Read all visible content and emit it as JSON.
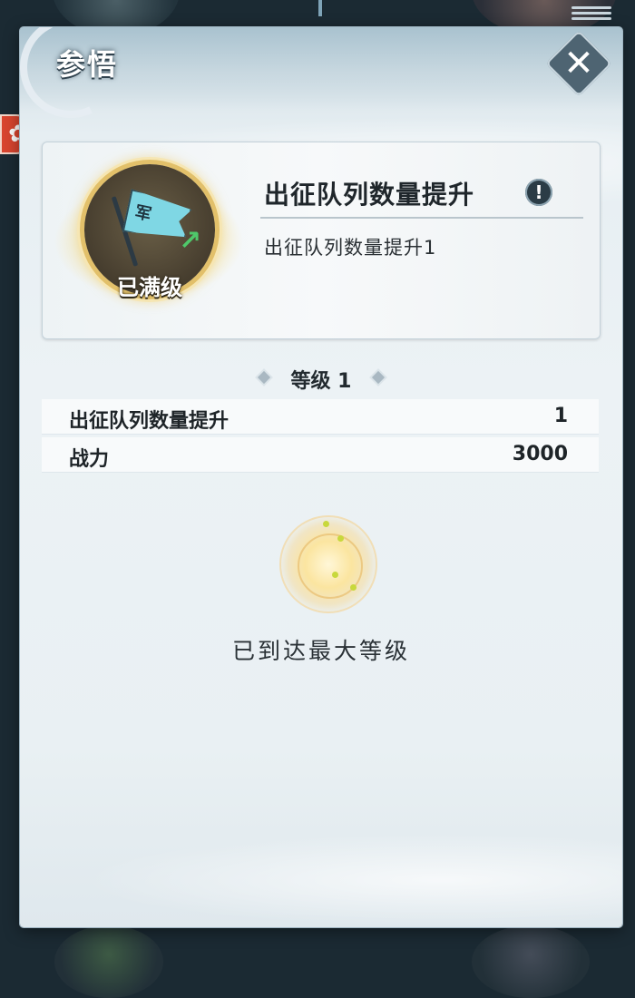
{
  "panel": {
    "title": "参悟",
    "close_symbol": "✕"
  },
  "side_badge": {
    "icon": "event-icon",
    "symbol": "✿"
  },
  "talent": {
    "icon": "army-flag-icon",
    "flag_char": "军",
    "status_label": "已满级",
    "name": "出征队列数量提升",
    "info_symbol": "!",
    "description": "出征队列数量提升1"
  },
  "level": {
    "heading": "等级 1"
  },
  "stats": [
    {
      "label": "出征队列数量提升",
      "value": "1"
    },
    {
      "label": "战力",
      "value": "3000"
    }
  ],
  "max_message": "已到达最大等级",
  "colors": {
    "panel_bg": "#ecf2f5",
    "header_bg": "#a9c2cf",
    "emblem_gold": "#e2c06a",
    "flag": "#7fd7e4",
    "upgrade_arrow": "#4fc86a",
    "badge_red": "#d9452f"
  }
}
